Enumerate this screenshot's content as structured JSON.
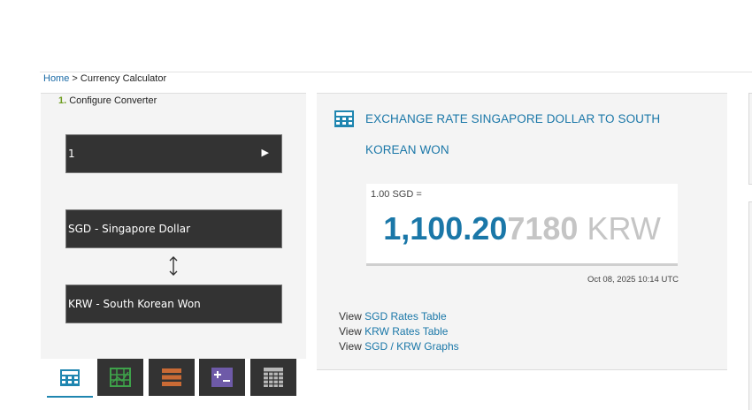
{
  "breadcrumb": {
    "home": "Home",
    "separator": ">",
    "current": "Currency Calculator"
  },
  "converter": {
    "step_number": "1.",
    "step_label": "Configure Converter",
    "amount": "1",
    "amount_arrow": "▶",
    "from_currency": "SGD - Singapore Dollar",
    "to_currency": "KRW - South Korean Won",
    "swap_icon": "up-down-arrow-icon"
  },
  "tabs": [
    {
      "icon": "calculator-icon",
      "color": "#1f86b0",
      "active": true
    },
    {
      "icon": "chart-grid-icon",
      "color": "#3ea24a",
      "active": false
    },
    {
      "icon": "list-bars-icon",
      "color": "#c96a35",
      "active": false
    },
    {
      "icon": "plus-minus-icon",
      "color": "#6e5aa8",
      "active": false
    },
    {
      "icon": "table-grid-icon",
      "color": "#b8b8b8",
      "active": false
    }
  ],
  "result": {
    "title": "EXCHANGE RATE SINGAPORE DOLLAR TO SOUTH KOREAN WON",
    "base": "1.00 SGD =",
    "rate_main": "1,100.20",
    "rate_rest": "7180",
    "rate_currency": "KRW",
    "timestamp": "Oct 08, 2025 10:14 UTC"
  },
  "links": [
    {
      "prefix": "View ",
      "label": "SGD Rates Table"
    },
    {
      "prefix": "View ",
      "label": "KRW Rates Table"
    },
    {
      "prefix": "View ",
      "label": "SGD / KRW Graphs"
    }
  ],
  "colors": {
    "accent": "#1a77a8",
    "dark_box": "#333333",
    "step_green": "#6d9c1f"
  }
}
